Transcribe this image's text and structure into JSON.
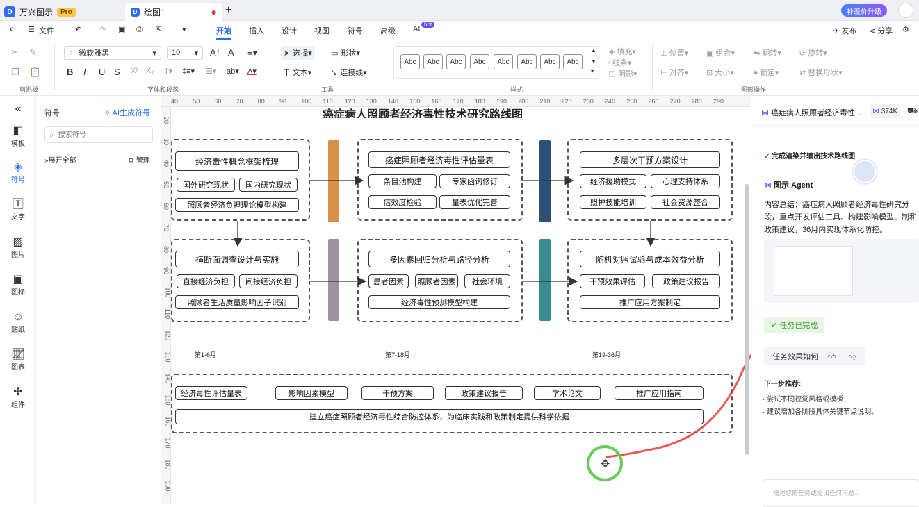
{
  "titlebar": {
    "app_name": "万兴图示",
    "pro_badge": "Pro",
    "doc_tab": "绘图1",
    "new_tab": "+",
    "upgrade": "补差价升级",
    "close": "×"
  },
  "menubar": {
    "file": "文件",
    "tabs": [
      "开始",
      "插入",
      "设计",
      "视图",
      "符号",
      "高级",
      "AI"
    ],
    "ai_badge": "hot",
    "publish": "发布",
    "share": "分享"
  },
  "ribbon": {
    "font_name": "微软雅黑",
    "font_size": "10",
    "select": "选择",
    "shape": "形状",
    "text": "文本",
    "connector": "连接线",
    "style_samples": [
      "Abc",
      "Abc",
      "Abc",
      "Abc",
      "Abc",
      "Abc",
      "Abc",
      "Abc"
    ],
    "fill": "填充",
    "line": "线条",
    "shadow": "阴影",
    "position": "位置",
    "group": "组合",
    "flip": "翻转",
    "rotate": "旋转",
    "align": "对齐",
    "size": "大小",
    "lock": "锁定",
    "replace": "替换形状",
    "group_labels": [
      "剪贴板",
      "字体和段落",
      "工具",
      "样式",
      "图形操作"
    ]
  },
  "rail": [
    {
      "label": "模板",
      "icon": "template-icon"
    },
    {
      "label": "符号",
      "icon": "symbol-icon"
    },
    {
      "label": "文字",
      "icon": "text-icon"
    },
    {
      "label": "图片",
      "icon": "image-icon"
    },
    {
      "label": "图标",
      "icon": "icon-icon"
    },
    {
      "label": "贴纸",
      "icon": "sticker-icon"
    },
    {
      "label": "图表",
      "icon": "chart-icon"
    },
    {
      "label": "组件",
      "icon": "component-icon"
    }
  ],
  "sympanel": {
    "title": "符号",
    "ai_gen": "AI生成符号",
    "search_placeholder": "搜索符号",
    "expand_all": "展开全部",
    "manage": "管理"
  },
  "ruler": {
    "top": [
      "40",
      "50",
      "60",
      "70",
      "80",
      "90",
      "100",
      "110",
      "120",
      "130",
      "140",
      "150",
      "160",
      "170",
      "180",
      "190",
      "200",
      "210",
      "220",
      "230",
      "240",
      "250",
      "260",
      "270",
      "280",
      "290"
    ],
    "left": [
      "20",
      "30",
      "40",
      "50",
      "60",
      "70",
      "80",
      "90",
      "100",
      "110",
      "120",
      "130",
      "140",
      "150",
      "160",
      "170",
      "180",
      "190"
    ]
  },
  "diagram": {
    "title": "癌症病人照顾者经济毒性技术研究路线图",
    "s1": {
      "main": "经济毒性概念框架梳理",
      "a": "国外研究现状",
      "b": "国内研究现状",
      "c": "照顾者经济负担理论模型构建"
    },
    "s2": {
      "main": "癌症照顾者经济毒性评估量表",
      "a": "条目池构建",
      "b": "专家函询修订",
      "c": "信效度检验",
      "d": "量表优化完善"
    },
    "s3": {
      "main": "多层次干预方案设计",
      "a": "经济援助模式",
      "b": "心理支持体系",
      "c": "照护技能培训",
      "d": "社会资源整合"
    },
    "s4": {
      "main": "横断面调查设计与实施",
      "a": "直接经济负担",
      "b": "间接经济负担",
      "c": "照顾者生活质量影响因子识别"
    },
    "s5": {
      "main": "多因素回归分析与路径分析",
      "a": "患者因素",
      "b": "照顾者因素",
      "c": "社会环境",
      "d": "经济毒性预测模型构建"
    },
    "s6": {
      "main": "随机对照试验与成本效益分析",
      "a": "干预效果评估",
      "b": "政策建议报告",
      "c": "推广应用方案制定"
    },
    "phases": [
      "第1-6月",
      "第7-18月",
      "第19-36月"
    ],
    "outputs": [
      "经济毒性评估量表",
      "影响因素模型",
      "干预方案",
      "政策建议报告",
      "学术论文",
      "推广应用指南"
    ],
    "conclusion": "建立癌症照顾者经济毒性综合防控体系，为临床实践和政策制定提供科学依据",
    "bar_colors": [
      "#d9914a",
      "#2e5078",
      "#9e93a3",
      "#3a8c8f"
    ]
  },
  "rpanel": {
    "doc_title": "癌症病人照顾者经济毒性...",
    "tokens": "374K",
    "done_step": "完成渲染并输出技术路线图",
    "agent_name": "图示 Agent",
    "summary": "内容总结：癌症病人照顾者经济毒性研究分段，重点开发评估工具、构建影响模型、制和政策建议，36月内实现体系化防控。",
    "task_done": "任务已完成",
    "feedback": "任务效果如何",
    "next_title": "下一步推荐:",
    "next_items": [
      "· 尝试不同视觉风格或模板",
      "· 建议增加各阶段具体关键节点说明。"
    ],
    "input_placeholder": "描述您的任务或提出任何问题..."
  }
}
